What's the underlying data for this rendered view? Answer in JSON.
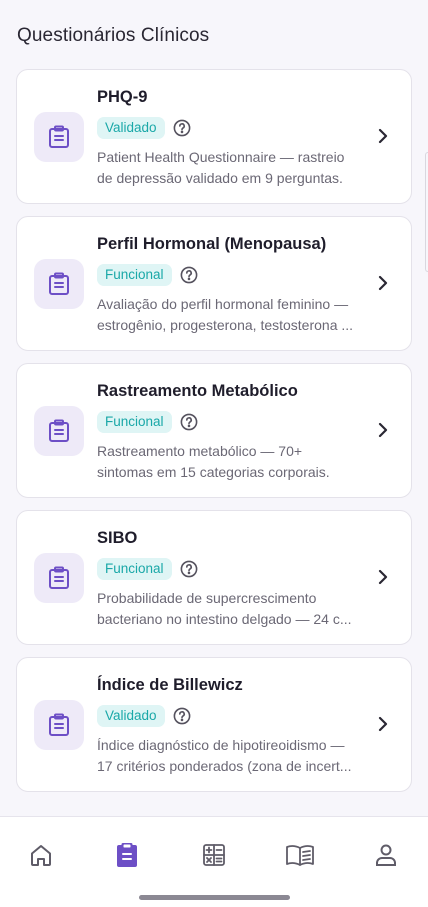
{
  "header": {
    "title": "Questionários Clínicos"
  },
  "questionnaires": [
    {
      "title": "PHQ-9",
      "badge": "Validado",
      "desc_line1": "Patient Health Questionnaire — rastreio",
      "desc_line2": "de depressão validado em 9 perguntas."
    },
    {
      "title": "Perfil Hormonal (Menopausa)",
      "badge": "Funcional",
      "desc_line1": "Avaliação do perfil hormonal feminino —",
      "desc_line2": "estrogênio, progesterona, testosterona ..."
    },
    {
      "title": "Rastreamento Metabólico",
      "badge": "Funcional",
      "desc_line1": "Rastreamento metabólico — 70+",
      "desc_line2": "sintomas em 15 categorias corporais."
    },
    {
      "title": "SIBO",
      "badge": "Funcional",
      "desc_line1": "Probabilidade de supercrescimento",
      "desc_line2": "bacteriano no intestino delgado — 24 c..."
    },
    {
      "title": "Índice de Billewicz",
      "badge": "Validado",
      "desc_line1": "Índice diagnóstico de hipotireoidismo —",
      "desc_line2": "17 critérios ponderados (zona de incert..."
    }
  ],
  "icons": {
    "card": "clipboard-list-icon",
    "help": "help-circle-icon",
    "chevron": "chevron-right-icon"
  },
  "nav": {
    "items": [
      "home-icon",
      "clipboard-icon",
      "calculator-icon",
      "book-icon",
      "user-icon"
    ],
    "active_index": 1
  },
  "colors": {
    "accent": "#6d4fc6",
    "icon_bg": "#eeeaf8",
    "badge_bg": "#dff5f5",
    "badge_text": "#1aa8a8",
    "nav_inactive": "#5f5c68"
  }
}
